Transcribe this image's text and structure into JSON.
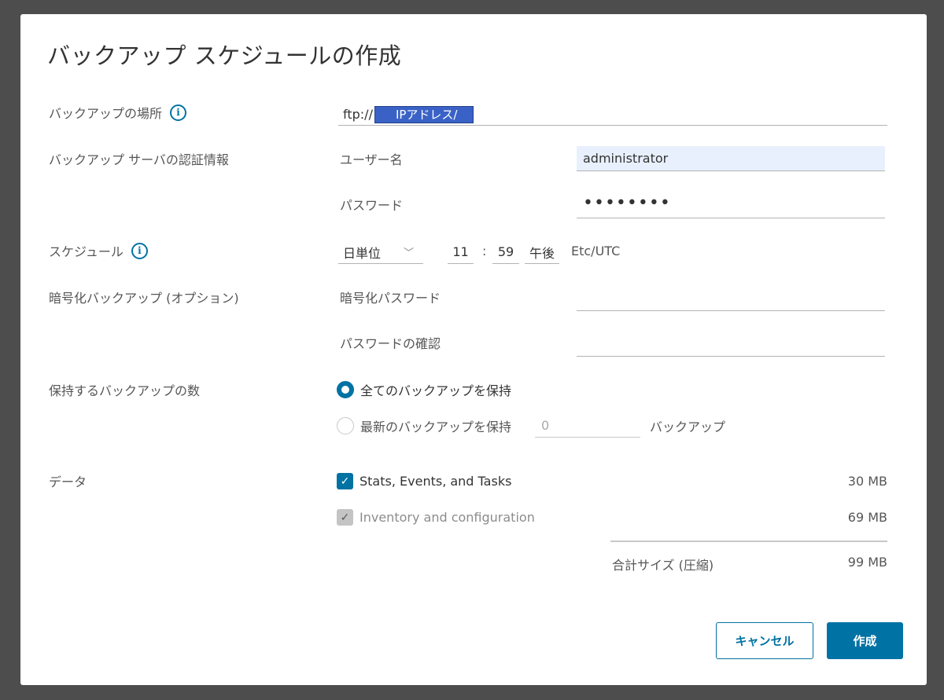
{
  "dialog": {
    "title": "バックアップ スケジュールの作成"
  },
  "location": {
    "label": "バックアップの場所",
    "url_prefix": "ftp://",
    "url_highlight": "IPアドレス/"
  },
  "credentials": {
    "label": "バックアップ サーバの認証情報",
    "username_label": "ユーザー名",
    "username_value": "administrator",
    "password_label": "パスワード",
    "password_value": "••••••••"
  },
  "schedule": {
    "label": "スケジュール",
    "frequency": "日単位",
    "hour": "11",
    "colon": ":",
    "minute": "59",
    "ampm": "午後",
    "timezone": "Etc/UTC"
  },
  "encryption": {
    "label": "暗号化バックアップ (オプション)",
    "password_label": "暗号化パスワード",
    "confirm_label": "パスワードの確認"
  },
  "retention": {
    "label": "保持するバックアップの数",
    "keep_all_label": "全てのバックアップを保持",
    "keep_latest_label": "最新のバックアップを保持",
    "count_placeholder": "0",
    "unit_label": "バックアップ"
  },
  "data": {
    "label": "データ",
    "items": [
      {
        "label": "Stats, Events, and Tasks",
        "size": "30 MB",
        "checked": true,
        "disabled": false
      },
      {
        "label": "Inventory and configuration",
        "size": "69 MB",
        "checked": true,
        "disabled": true
      }
    ],
    "total_label": "合計サイズ (圧縮)",
    "total_size": "99 MB"
  },
  "buttons": {
    "cancel": "キャンセル",
    "create": "作成"
  },
  "colors": {
    "accent": "#0072a3",
    "highlight": "#3a62c6",
    "backdrop": "#4d4d4d"
  },
  "icons": {
    "info": "info-icon",
    "chevron": "chevron-down-icon",
    "check": "checkmark-icon"
  }
}
